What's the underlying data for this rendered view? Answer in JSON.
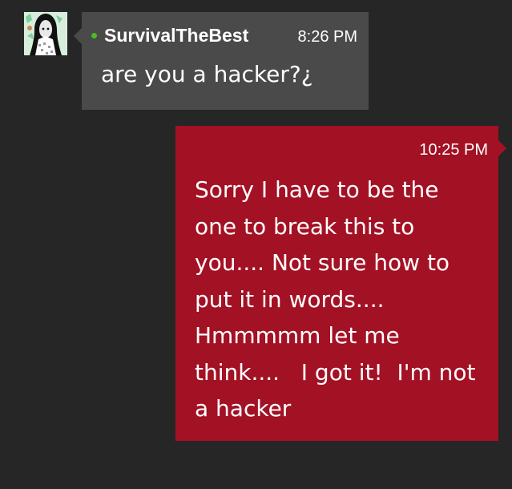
{
  "conversation": {
    "messages": [
      {
        "direction": "incoming",
        "sender": "SurvivalTheBest",
        "time": "8:26 PM",
        "text": "are you a hacker?¿",
        "presence": "online",
        "bubble_color": "#4a4a4a"
      },
      {
        "direction": "outgoing",
        "time": "10:25 PM",
        "lines": [
          "Sorry I have to be the",
          "one to break this to",
          "you.... Not sure how to",
          "put it in words....",
          "Hmmmmm let me",
          "think....   I got it!  I'm not",
          "a hacker"
        ],
        "bubble_color": "#a31124"
      }
    ]
  },
  "colors": {
    "background": "#262626",
    "presence_online": "#4cbb2a"
  }
}
